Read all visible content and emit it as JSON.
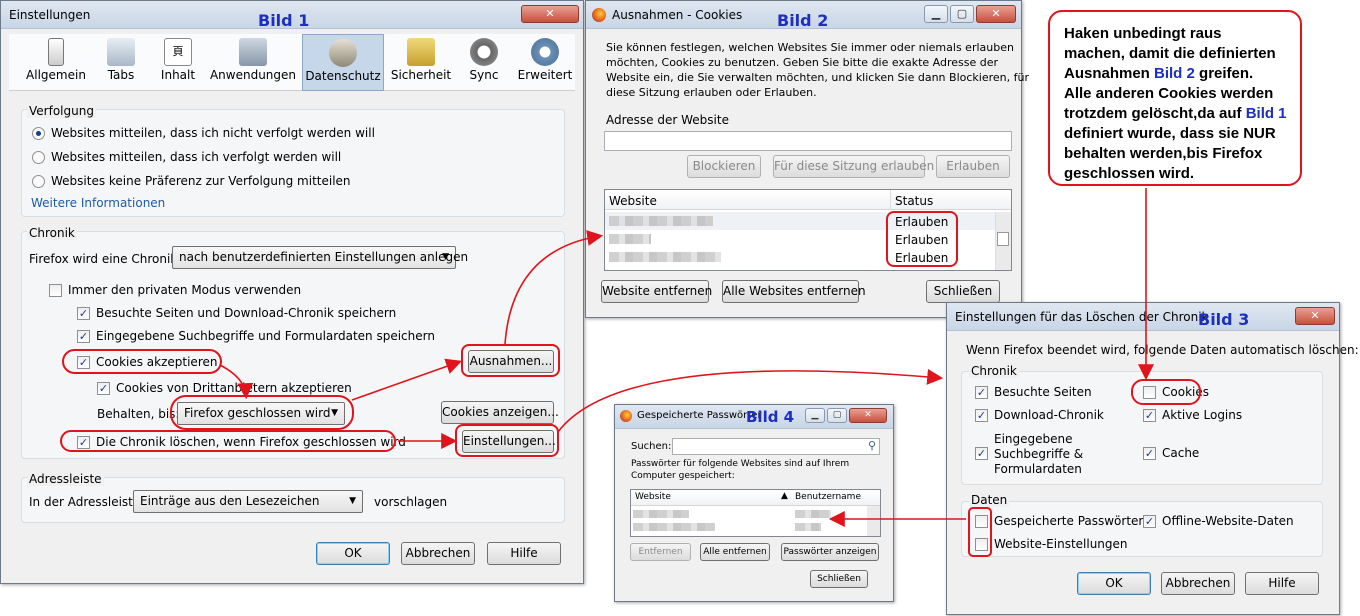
{
  "labels": {
    "b1": "Bild 1",
    "b2": "Bild 2",
    "b3": "Bild 3",
    "b4": "Bild 4"
  },
  "w1": {
    "title": "Einstellungen",
    "tabs": [
      "Allgemein",
      "Tabs",
      "Inhalt",
      "Anwendungen",
      "Datenschutz",
      "Sicherheit",
      "Sync",
      "Erweitert"
    ],
    "verfolgung": {
      "title": "Verfolgung",
      "opt1": "Websites mitteilen, dass ich nicht verfolgt werden will",
      "opt2": "Websites mitteilen, dass ich verfolgt werden will",
      "opt3": "Websites keine Präferenz zur Verfolgung mitteilen",
      "link": "Weitere Informationen"
    },
    "chronik": {
      "title": "Chronik",
      "label": "Firefox wird eine Chronik:",
      "select": "nach benutzerdefinierten Einstellungen anlegen",
      "private": "Immer den privaten Modus verwenden",
      "visited": "Besuchte Seiten und Download-Chronik speichern",
      "search": "Eingegebene Suchbegriffe und Formulardaten speichern",
      "cookies": "Cookies akzeptieren",
      "third": "Cookies von Drittanbietern akzeptieren",
      "keep_label": "Behalten, bis:",
      "keep_select": "Firefox geschlossen wird",
      "clear": "Die Chronik löschen, wenn Firefox geschlossen wird",
      "btn_ausnahmen": "Ausnahmen...",
      "btn_cookies": "Cookies anzeigen...",
      "btn_settings": "Einstellungen..."
    },
    "adress": {
      "title": "Adressleiste",
      "label": "In der Adressleiste",
      "select": "Einträge aus den Lesezeichen",
      "suffix": "vorschlagen"
    },
    "ok": "OK",
    "cancel": "Abbrechen",
    "help": "Hilfe"
  },
  "w2": {
    "title": "Ausnahmen - Cookies",
    "intro1": "Sie können festlegen, welchen Websites Sie immer oder niemals erlauben",
    "intro2": "möchten, Cookies zu benutzen. Geben Sie bitte die exakte Adresse der",
    "intro3": "Website ein, die Sie verwalten möchten, und klicken Sie dann Blockieren, für",
    "intro4": "diese Sitzung erlauben oder Erlauben.",
    "addr_label": "Adresse der Website",
    "block": "Blockieren",
    "session": "Für diese Sitzung erlauben",
    "allow": "Erlauben",
    "col_site": "Website",
    "col_status": "Status",
    "rows": [
      "Erlauben",
      "Erlauben",
      "Erlauben"
    ],
    "remove": "Website entfernen",
    "remove_all": "Alle Websites entfernen",
    "close": "Schließen"
  },
  "w3": {
    "title": "Einstellungen für das Löschen der Chronik",
    "intro": "Wenn Firefox beendet wird, folgende Daten automatisch löschen:",
    "chronik": "Chronik",
    "visited": "Besuchte Seiten",
    "cookies": "Cookies",
    "downloads": "Download-Chronik",
    "logins": "Aktive Logins",
    "forms1": "Eingegebene",
    "forms2": "Suchbegriffe &",
    "forms3": "Formulardaten",
    "cache": "Cache",
    "daten": "Daten",
    "passwords": "Gespeicherte Passwörter",
    "offline": "Offline-Website-Daten",
    "sitesettings": "Website-Einstellungen",
    "ok": "OK",
    "cancel": "Abbrechen",
    "help": "Hilfe"
  },
  "w4": {
    "title": "Gespeicherte Passwörter",
    "search": "Suchen:",
    "info1": "Passwörter für folgende Websites sind auf Ihrem",
    "info2": "Computer gespeichert:",
    "col_site": "Website",
    "col_user": "Benutzername",
    "remove": "Entfernen",
    "remove_all": "Alle entfernen",
    "show": "Passwörter anzeigen",
    "close": "Schließen"
  },
  "note": {
    "l1": "Haken unbedingt raus",
    "l2": "machen, damit die definierten",
    "l3a": "Ausnahmen ",
    "l3b": "Bild 2",
    "l3c": " greifen.",
    "l4": "Alle anderen Cookies werden",
    "l5a": "trotzdem gelöscht,da auf ",
    "l5b": "Bild 1",
    "l6": "definiert wurde, dass sie NUR",
    "l7": "behalten werden,bis Firefox",
    "l8": "geschlossen wird."
  },
  "colors": {
    "annotation": "#e0141c",
    "label": "#1c2fc0"
  }
}
